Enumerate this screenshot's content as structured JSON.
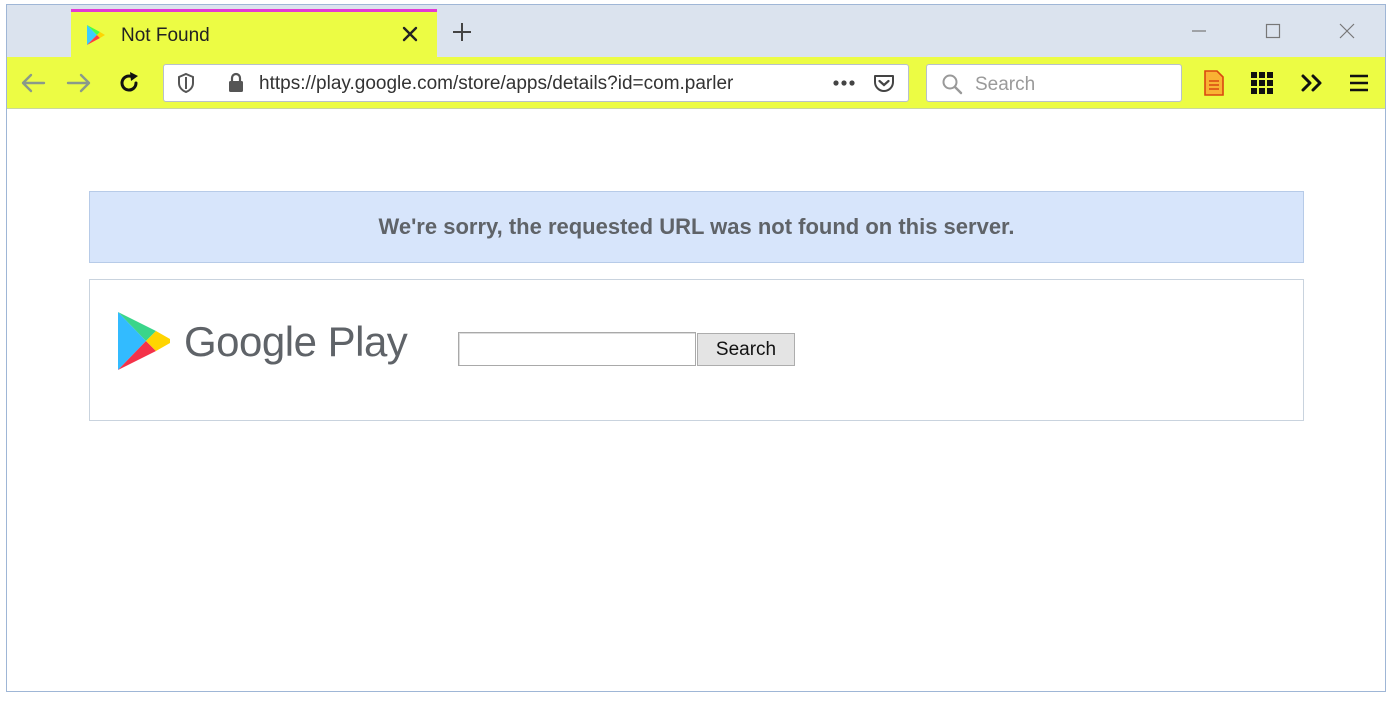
{
  "browser": {
    "tab": {
      "title": "Not Found",
      "accent_color": "#e33ad3",
      "background": "#ecfc44"
    },
    "toolbar": {
      "url": "https://play.google.com/store/apps/details?id=com.parler",
      "search_placeholder": "Search",
      "background": "#ecfc44"
    },
    "icons": {
      "tab_favicon": "google-play-icon",
      "tab_close": "close-icon",
      "new_tab": "plus-icon",
      "back": "arrow-left-icon",
      "forward": "arrow-right-icon",
      "reload": "reload-icon",
      "site_info": "shield-icon",
      "secure": "lock-icon",
      "page_actions": "more-dots-icon",
      "pocket": "pocket-icon",
      "search": "magnifier-icon",
      "reader": "document-icon",
      "apps": "grid-icon",
      "overflow": "chevrons-right-icon",
      "menu": "hamburger-icon"
    }
  },
  "page": {
    "error_message": "We're sorry, the requested URL was not found on this server.",
    "brand_name": "Google Play",
    "search": {
      "value": "",
      "button_label": "Search"
    },
    "colors": {
      "banner": "#d7e5fb",
      "text": "#5f6368"
    }
  }
}
